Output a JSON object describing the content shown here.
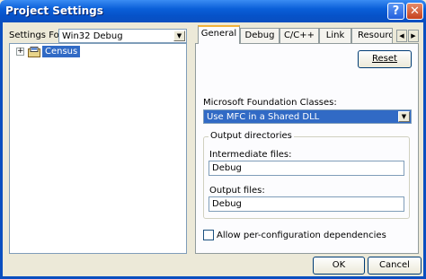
{
  "window": {
    "title": "Project Settings",
    "help_glyph": "?",
    "close_glyph": "✕"
  },
  "left": {
    "settings_for_label": "Settings For:",
    "settings_for_value": "Win32 Debug",
    "tree": {
      "expander": "+",
      "item_label": "Census"
    }
  },
  "tabs": [
    {
      "label": "General"
    },
    {
      "label": "Debug"
    },
    {
      "label": "C/C++"
    },
    {
      "label": "Link"
    },
    {
      "label": "Resource"
    }
  ],
  "tab_scroll": {
    "left": "◀",
    "right": "▶"
  },
  "general": {
    "reset_label": "Reset",
    "mfc_label": "Microsoft Foundation Classes:",
    "mfc_value": "Use MFC in a Shared DLL",
    "output_group_title": "Output directories",
    "intermediate_label": "Intermediate files:",
    "intermediate_value": "Debug",
    "output_label": "Output files:",
    "output_value": "Debug",
    "allow_deps_label": "Allow per-configuration dependencies",
    "allow_deps_checked": false
  },
  "footer": {
    "ok_label": "OK",
    "cancel_label": "Cancel"
  },
  "colors": {
    "titlebar": "#0a5fd8",
    "face": "#ece9d8",
    "selection": "#316ac5",
    "tab_highlight": "#f2b23a"
  }
}
